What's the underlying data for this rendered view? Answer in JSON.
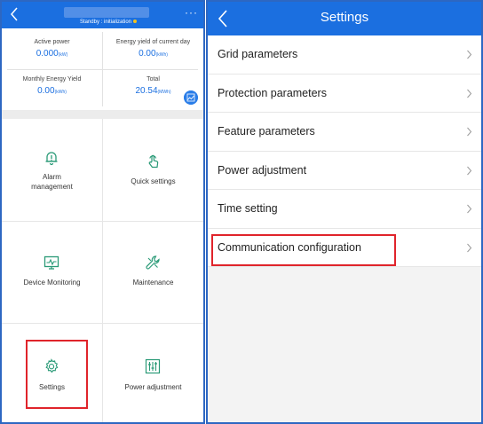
{
  "left_screen": {
    "header": {
      "status_text": "Standby : initialization",
      "more_glyph": "···"
    },
    "stats": [
      {
        "label": "Active power",
        "value": "0.000",
        "unit": "(kW)"
      },
      {
        "label": "Energy yield of current day",
        "value": "0.00",
        "unit": "(kWh)"
      },
      {
        "label": "Monthly Energy Yield",
        "value": "0.00",
        "unit": "(kWh)"
      },
      {
        "label": "Total",
        "value": "20.54",
        "unit": "(MWh)"
      }
    ],
    "tiles": [
      {
        "label": "Alarm\nmanagement",
        "icon": "bell-alert-icon"
      },
      {
        "label": "Quick settings",
        "icon": "touch-hand-icon"
      },
      {
        "label": "Device Monitoring",
        "icon": "monitor-icon"
      },
      {
        "label": "Maintenance",
        "icon": "wrench-icon"
      },
      {
        "label": "Settings",
        "icon": "gear-icon"
      },
      {
        "label": "Power adjustment",
        "icon": "sliders-icon"
      }
    ]
  },
  "right_screen": {
    "title": "Settings",
    "menu": [
      {
        "label": "Grid parameters"
      },
      {
        "label": "Protection parameters"
      },
      {
        "label": "Feature parameters"
      },
      {
        "label": "Power adjustment"
      },
      {
        "label": "Time setting"
      },
      {
        "label": "Communication configuration"
      }
    ]
  },
  "colors": {
    "header_blue": "#1b6fe0",
    "value_blue": "#1b6fe0",
    "highlight_red": "#e0242b",
    "frame_blue": "#2d67c2"
  }
}
